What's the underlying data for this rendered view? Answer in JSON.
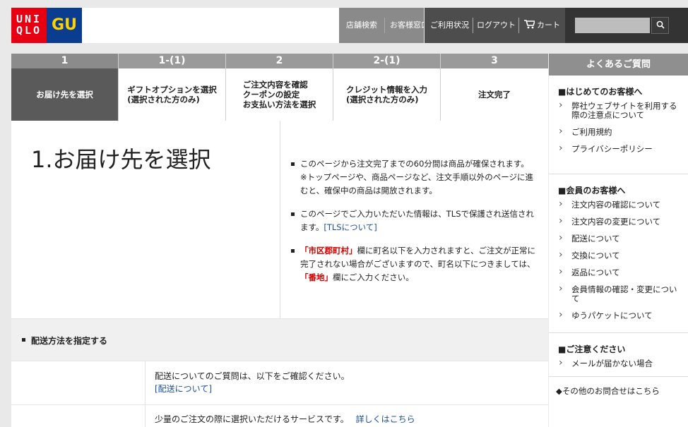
{
  "header": {
    "logo_uniqlo_line1": "UNI",
    "logo_uniqlo_line2": "QLO",
    "logo_gu": "GU",
    "nav": [
      "店舗検索",
      "お客様窓口",
      "ご利用状況",
      "ログアウト",
      "カート"
    ],
    "search_button": "⌕",
    "colors": {
      "uniqlo_red": "#e60012",
      "gu_blue": "#0a3d8f",
      "gu_yellow": "#ffd200"
    }
  },
  "steps": [
    {
      "num": "1",
      "label": "お届け先を選択",
      "active": true
    },
    {
      "num": "1-(1)",
      "label": "ギフトオプションを選択\n(選択された方のみ)"
    },
    {
      "num": "2",
      "label": "ご注文内容を確認\nクーポンの設定\nお支払い方法を選択"
    },
    {
      "num": "2-(1)",
      "label": "クレジット情報を入力\n(選択された方のみ)"
    },
    {
      "num": "3",
      "label": "注文完了"
    }
  ],
  "main": {
    "title": "1.お届け先を選択",
    "info1": "このページから注文完了までの60分間は商品が確保されます。",
    "info1_note": "※トップページや、商品ページなど、注文手順以外のページに進むと、確保中の商品は開放されます。",
    "info2_text": "このページでご入力いただいた情報は、TLSで保護され送信されます。",
    "info2_link": "[TLSについて]",
    "info3_a": "「市区郡町村」",
    "info3_b": "欄に町名以下を入力されますと、ご注文が正常に完了されない場合がございますので、町名以下につきましては、",
    "info3_c": "「番地」",
    "info3_d": "欄にご入力ください。",
    "shipping_heading": "配送方法を指定する",
    "row1_text": "配送についてのご質問は、以下をご確認ください。",
    "row1_link": "[配送について]",
    "row2_text": "少量のご注文の際に選択いただけるサービスです。",
    "row2_link": "詳しくはこちら"
  },
  "faq": {
    "heading": "よくあるご質問",
    "sections": [
      {
        "title": "■はじめてのお客様へ",
        "items": [
          "弊社ウェブサイトを利用する際の注意点について",
          "ご利用規約",
          "プライバシーポリシー"
        ]
      },
      {
        "title": "■会員のお客様へ",
        "items": [
          "注文内容の確認について",
          "注文内容の変更について",
          "配送について",
          "交換について",
          "返品について",
          "会員情報の確認・変更について",
          "ゆうパケットについて"
        ]
      },
      {
        "title": "■ご注意ください",
        "items": [
          "メールが届かない場合"
        ]
      }
    ],
    "more": "◆その他のお問合せはこちら"
  }
}
